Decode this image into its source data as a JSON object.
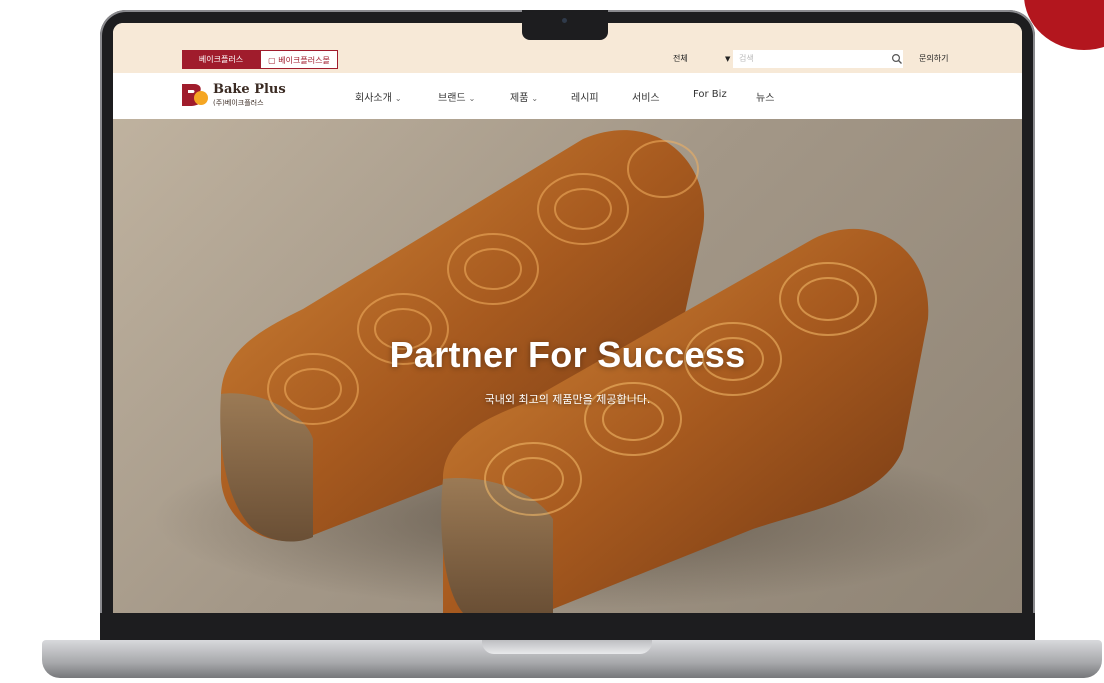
{
  "utility": {
    "tabs": [
      "베이크플러스",
      "베이크플러스몰"
    ],
    "search_scope": "전체",
    "search_placeholder": "검색",
    "contact": "문의하기"
  },
  "brand": {
    "name": "Bake Plus",
    "sub": "(주)베이크플러스",
    "accent_color": "#a01c2c"
  },
  "nav": {
    "items": [
      {
        "label": "회사소개",
        "has_dropdown": true
      },
      {
        "label": "브랜드",
        "has_dropdown": true
      },
      {
        "label": "제품",
        "has_dropdown": true
      },
      {
        "label": "레시피",
        "has_dropdown": false
      },
      {
        "label": "서비스",
        "has_dropdown": false
      },
      {
        "label": "For Biz",
        "has_dropdown": false
      },
      {
        "label": "뉴스",
        "has_dropdown": false
      }
    ]
  },
  "hero": {
    "title": "Partner For Success",
    "subtitle": "국내외 최고의 제품만을 제공합니다."
  },
  "icons": {
    "search": "search-icon",
    "logo": "bakeplus-logo-icon",
    "chevron": "chevron-down-icon"
  }
}
